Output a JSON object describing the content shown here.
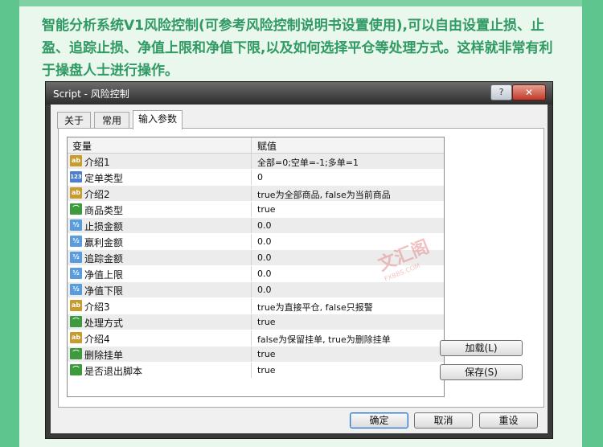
{
  "intro_text": "智能分析系统V1风险控制(可参考风险控制说明书设置使用),可以自由设置止损、止盈、追踪止损、净值上限和净值下限,以及如何选择平仓等处理方式。这样就非常有利于操盘人士进行操作。",
  "window": {
    "title": "Script - 风险控制",
    "help_label": "?",
    "close_label": "✕"
  },
  "tabs": [
    {
      "label": "关于",
      "active": false
    },
    {
      "label": "常用",
      "active": false
    },
    {
      "label": "输入参数",
      "active": true
    }
  ],
  "table": {
    "headers": {
      "variable": "变量",
      "value": "赋值"
    },
    "rows": [
      {
        "icon": "ab",
        "icon_label": "ab",
        "name": "介绍1",
        "value": "全部=0;空单=-1;多单=1"
      },
      {
        "icon": "n123",
        "icon_label": "123",
        "name": "定单类型",
        "value": "0"
      },
      {
        "icon": "ab",
        "icon_label": "ab",
        "name": "介绍2",
        "value": "true为全部商品, false为当前商品"
      },
      {
        "icon": "bool",
        "icon_label": "⌒",
        "name": "商品类型",
        "value": "true"
      },
      {
        "icon": "dbl",
        "icon_label": "½",
        "name": "止损金额",
        "value": "0.0"
      },
      {
        "icon": "dbl",
        "icon_label": "½",
        "name": "赢利金额",
        "value": "0.0"
      },
      {
        "icon": "dbl",
        "icon_label": "½",
        "name": "追踪金额",
        "value": "0.0"
      },
      {
        "icon": "dbl",
        "icon_label": "½",
        "name": "净值上限",
        "value": "0.0"
      },
      {
        "icon": "dbl",
        "icon_label": "½",
        "name": "净值下限",
        "value": "0.0"
      },
      {
        "icon": "ab",
        "icon_label": "ab",
        "name": "介绍3",
        "value": "true为直接平仓, false只报警"
      },
      {
        "icon": "bool",
        "icon_label": "⌒",
        "name": "处理方式",
        "value": "true"
      },
      {
        "icon": "ab",
        "icon_label": "ab",
        "name": "介绍4",
        "value": "false为保留挂单, true为删除挂单"
      },
      {
        "icon": "bool",
        "icon_label": "⌒",
        "name": "删除挂单",
        "value": "true"
      },
      {
        "icon": "bool",
        "icon_label": "⌒",
        "name": "是否退出脚本",
        "value": "true"
      }
    ]
  },
  "side_buttons": {
    "load": "加载(L)",
    "save": "保存(S)"
  },
  "bottom_buttons": {
    "ok": "确定",
    "cancel": "取消",
    "reset": "重设"
  },
  "watermark": {
    "main": "文汇阁",
    "sub": "FXBBS.COM"
  },
  "colors": {
    "page_bg": "#5fc58f",
    "panel_bg": "#eaf7ec",
    "intro_text": "#2f9a63",
    "titlebar": "#2c2c2c"
  }
}
